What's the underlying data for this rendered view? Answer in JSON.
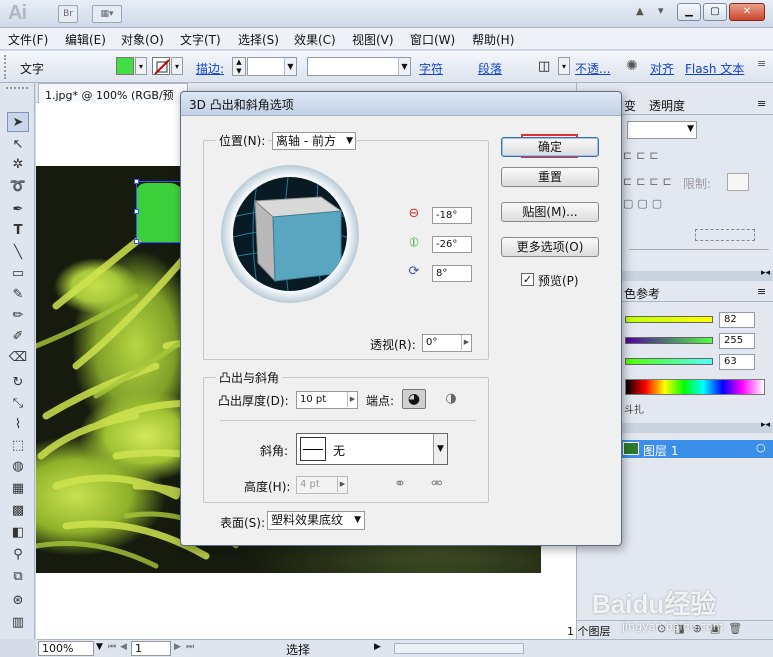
{
  "app": {
    "logo": "Ai",
    "bridge_label": "Br"
  },
  "menu": [
    "文件(F)",
    "编辑(E)",
    "对象(O)",
    "文字(T)",
    "选择(S)",
    "效果(C)",
    "视图(V)",
    "窗口(W)",
    "帮助(H)"
  ],
  "control_bar": {
    "type_label": "文字",
    "stroke_label": "描边:",
    "char_link": "字符",
    "para_link": "段落",
    "opacity_link": "不透...",
    "align_link": "对齐",
    "flash_link": "Flash 文本"
  },
  "document": {
    "tab_title": "1.jpg* @ 100% (RGB/预览)"
  },
  "status_bar": {
    "zoom": "100%",
    "page": "1",
    "tool": "选择"
  },
  "right_panel": {
    "tabs_top": [
      "变",
      "透明度"
    ],
    "limit_label": "限制:",
    "color_ref_tab": "色参考",
    "rgb_values": [
      "82",
      "255",
      "63"
    ],
    "layers_label": "图层 1",
    "layers_count": "1 个图层"
  },
  "dialog": {
    "title": "3D 凸出和斜角选项",
    "position_label": "位置(N):",
    "position_value": "离轴 - 前方",
    "rot_x": "-18°",
    "rot_y": "-26°",
    "rot_z": "8°",
    "perspective_label": "透视(R):",
    "perspective_value": "0°",
    "extrude_group": "凸出与斜角",
    "extrude_depth_label": "凸出厚度(D):",
    "extrude_depth_value": "10 pt",
    "cap_label": "端点:",
    "bevel_label": "斜角:",
    "bevel_value": "无",
    "height_label": "高度(H):",
    "height_value": "4 pt",
    "surface_label": "表面(S):",
    "surface_value": "塑料效果底纹",
    "ok": "确定",
    "reset": "重置",
    "map": "贴图(M)...",
    "more_options": "更多选项(O)",
    "preview": "预览(P)",
    "preview_checked": true
  },
  "colors": {
    "accent_blue": "#3b8fe8",
    "cube_front": "#5aa6c0",
    "cube_side": "#b9b9b9",
    "ok_highlight": "#e03030",
    "fill_swatch": "#44dd44"
  },
  "watermark": {
    "brand": "Baidu经验",
    "url": "jingyan.baidu.com"
  }
}
